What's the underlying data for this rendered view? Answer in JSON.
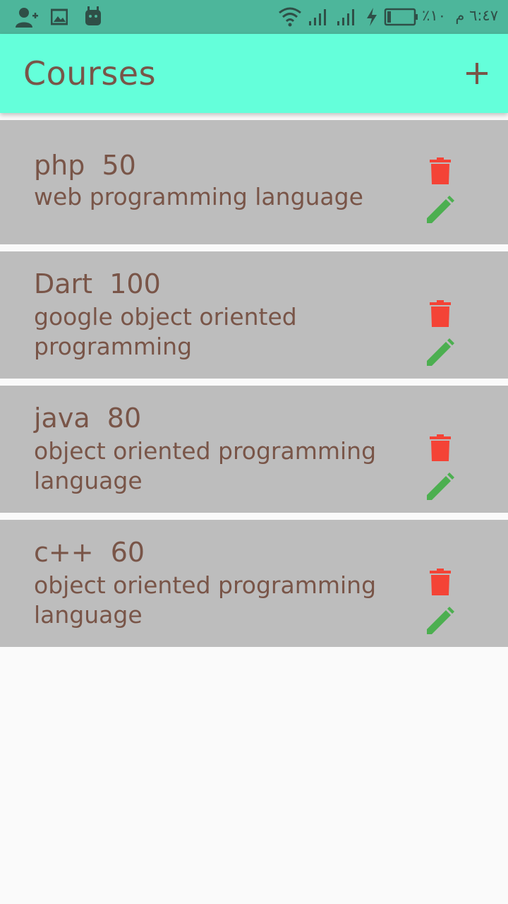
{
  "status_bar": {
    "time": "٦:٤٧ م",
    "battery_percent": "٪١٠",
    "icons": [
      "add-contact-icon",
      "image-icon",
      "android-icon",
      "wifi-icon",
      "signal-icon",
      "signal-icon",
      "charging-icon",
      "battery-icon"
    ]
  },
  "app_bar": {
    "title": "Courses",
    "add_icon": "plus-icon",
    "background": "#64ffda"
  },
  "courses": [
    {
      "name": "php",
      "hours": "50",
      "description": "web programming language"
    },
    {
      "name": "Dart",
      "hours": "100",
      "description": "google object oriented programming"
    },
    {
      "name": "java",
      "hours": "80",
      "description": "object oriented programming language"
    },
    {
      "name": "c++",
      "hours": "60",
      "description": "object oriented programming language"
    }
  ],
  "colors": {
    "text": "#795548",
    "card": "#bdbdbd",
    "delete": "#f44336",
    "edit": "#4caf50",
    "status_bar": "#4db69b"
  }
}
